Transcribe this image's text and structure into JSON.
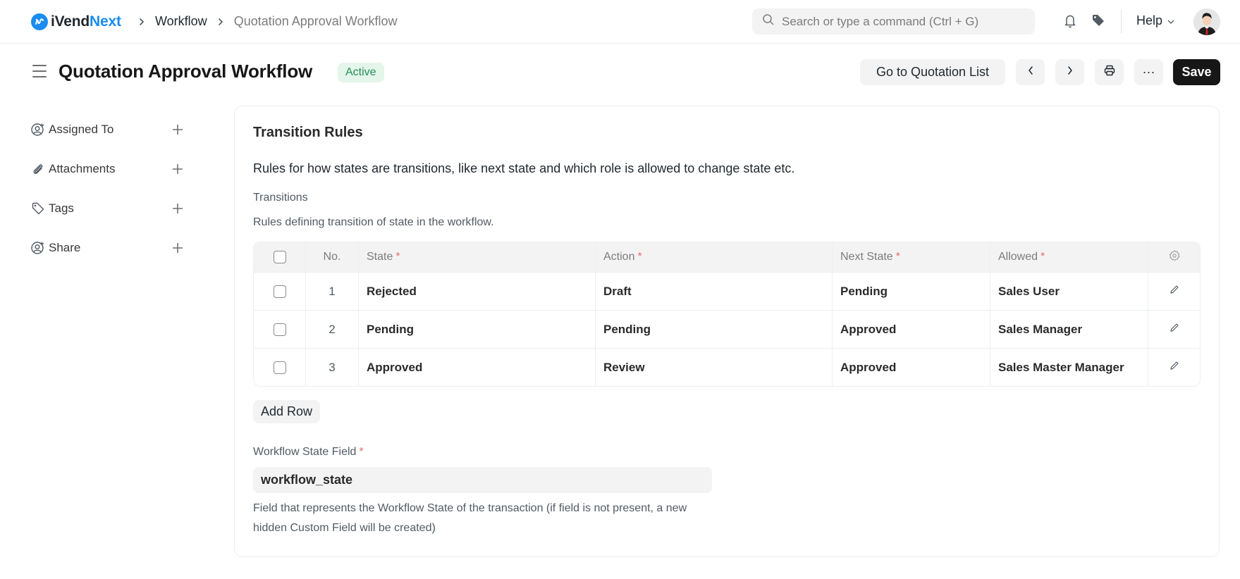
{
  "navbar": {
    "brand": {
      "part1": "iVend",
      "part2": "Next",
      "brand_color": "#1a8cf0"
    },
    "breadcrumbs": [
      {
        "label": "Workflow"
      },
      {
        "label": "Quotation Approval Workflow"
      }
    ],
    "search": {
      "placeholder": "Search or type a command (Ctrl + G)",
      "value": ""
    },
    "icons": {
      "notifications": "bell-icon",
      "tags": "tag-icon"
    },
    "help_label": "Help"
  },
  "page": {
    "title": "Quotation Approval Workflow",
    "status": "Active",
    "status_color": "#278f5e",
    "actions": {
      "go_to_list": "Go to Quotation List",
      "prev": "previous-icon",
      "next": "next-icon",
      "print": "printer-icon",
      "more": "···",
      "save": "Save"
    }
  },
  "sidebar": {
    "items": [
      {
        "label": "Assigned To",
        "icon": "user-add-icon"
      },
      {
        "label": "Attachments",
        "icon": "paperclip-icon"
      },
      {
        "label": "Tags",
        "icon": "tag-icon"
      },
      {
        "label": "Share",
        "icon": "share-user-icon"
      }
    ]
  },
  "section": {
    "title": "Transition Rules",
    "description": "Rules for how states are transitions, like next state and which role is allowed to change state etc.",
    "table_label": "Transitions",
    "table_description": "Rules defining transition of state in the workflow.",
    "table": {
      "columns": {
        "no": "No.",
        "state": "State",
        "action": "Action",
        "next_state": "Next State",
        "allowed": "Allowed",
        "required_marker": "*"
      },
      "rows": [
        {
          "no": "1",
          "state": "Rejected",
          "action": "Draft",
          "next_state": "Pending",
          "allowed": "Sales User"
        },
        {
          "no": "2",
          "state": "Pending",
          "action": "Pending",
          "next_state": "Approved",
          "allowed": "Sales Manager"
        },
        {
          "no": "3",
          "state": "Approved",
          "action": "Review",
          "next_state": "Approved",
          "allowed": "Sales Master Manager"
        }
      ]
    },
    "add_row_label": "Add Row",
    "workflow_state_field": {
      "label": "Workflow State Field",
      "required_marker": "*",
      "value": "workflow_state",
      "help": "Field that represents the Workflow State of the transaction (if field is not present, a new hidden Custom Field will be created)"
    }
  }
}
